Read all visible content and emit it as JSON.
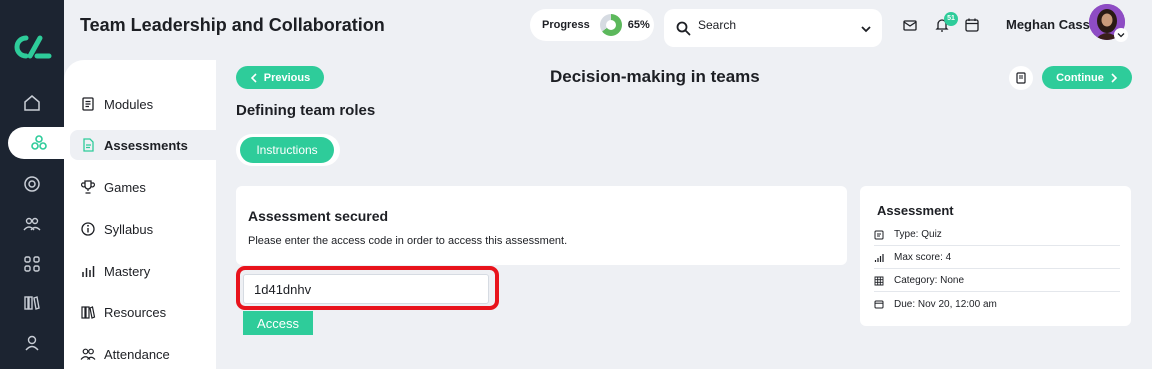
{
  "app": {
    "title": "Team Leadership and Collaboration"
  },
  "colors": {
    "accent": "#2ecc9a",
    "rail": "#1c2431",
    "highlight": "#e8131c"
  },
  "header": {
    "progress_label": "Progress",
    "progress_value": "65%",
    "progress_fraction": 0.65,
    "search_placeholder": "Search",
    "notification_count": "51",
    "user_name": "Meghan Cass"
  },
  "rail": {
    "icons": [
      "home-icon",
      "network-icon",
      "target-icon",
      "people-icon",
      "grid-icon",
      "library-icon",
      "user-icon"
    ],
    "active": "network-icon"
  },
  "sidebar": {
    "items": [
      {
        "label": "Modules",
        "icon": "book-icon"
      },
      {
        "label": "Assessments",
        "icon": "document-icon"
      },
      {
        "label": "Games",
        "icon": "trophy-icon"
      },
      {
        "label": "Syllabus",
        "icon": "info-icon"
      },
      {
        "label": "Mastery",
        "icon": "bar-chart-icon"
      },
      {
        "label": "Resources",
        "icon": "books-icon"
      },
      {
        "label": "Attendance",
        "icon": "people-icon"
      }
    ],
    "active": "Assessments"
  },
  "nav": {
    "previous_label": "Previous",
    "continue_label": "Continue",
    "page_title": "Decision-making in teams"
  },
  "section": {
    "title": "Defining team roles",
    "instructions_label": "Instructions"
  },
  "secured": {
    "title": "Assessment secured",
    "description": "Please enter the access code in order to access this assessment.",
    "code_value": "1d41dnhv",
    "access_label": "Access"
  },
  "assessment": {
    "title": "Assessment",
    "type": "Type: Quiz",
    "max_score": "Max score: 4",
    "category": "Category: None",
    "due": "Due: Nov 20, 12:00 am"
  }
}
